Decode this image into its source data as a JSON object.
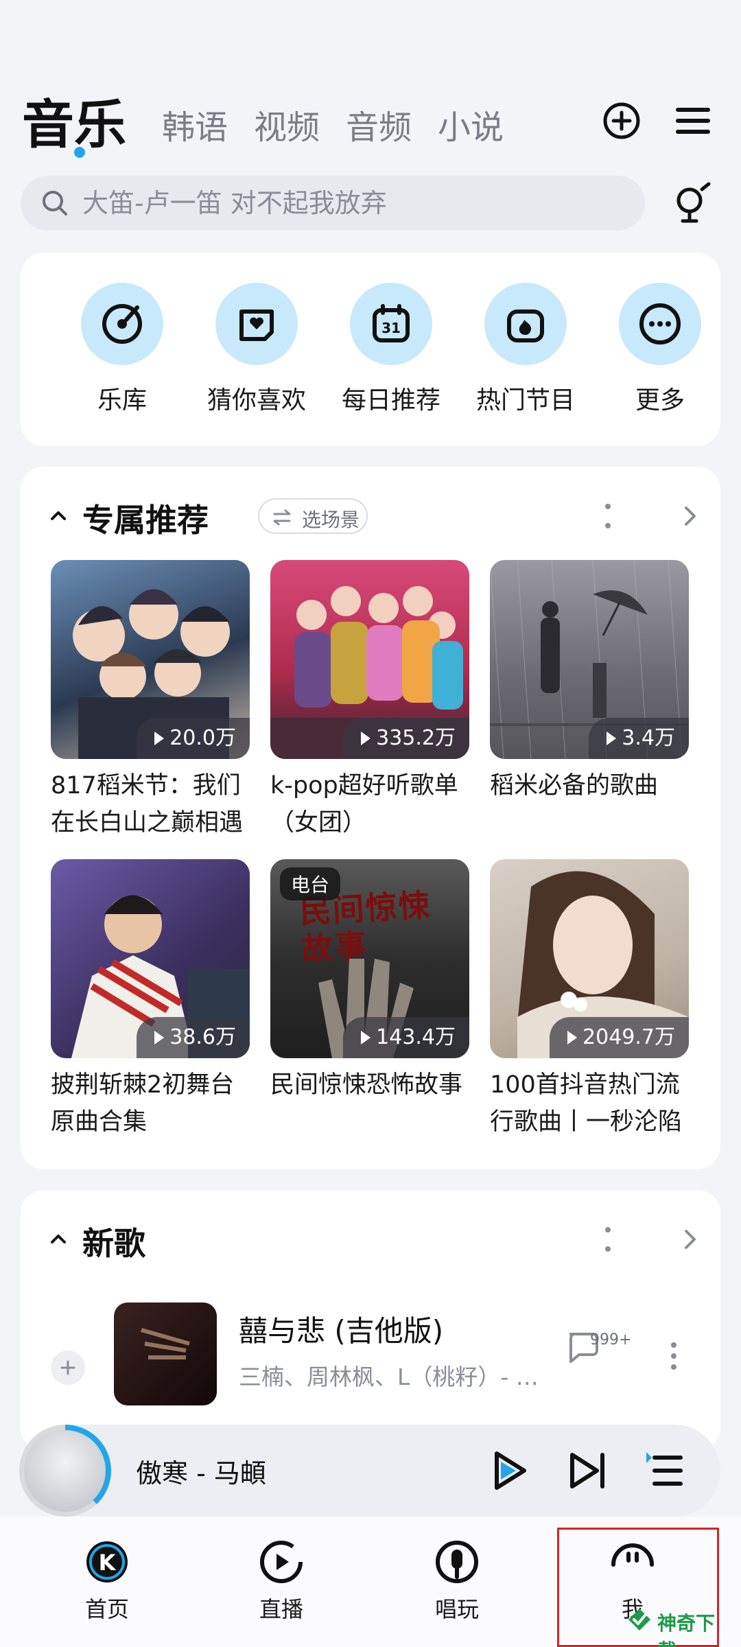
{
  "top_tabs": {
    "active": "音乐",
    "items": [
      "韩语",
      "视频",
      "音频",
      "小说"
    ]
  },
  "search": {
    "placeholder": "大笛-卢一笛 对不起我放弃"
  },
  "quick_entries": [
    {
      "label": "乐库",
      "icon": "vinyl-icon"
    },
    {
      "label": "猜你喜欢",
      "icon": "heart-box-icon"
    },
    {
      "label": "每日推荐",
      "icon": "calendar-icon"
    },
    {
      "label": "热门节目",
      "icon": "flame-icon"
    },
    {
      "label": "更多",
      "icon": "more-dots-icon"
    }
  ],
  "recommend": {
    "title": "专属推荐",
    "chip": "选场景",
    "tiles": [
      {
        "title": "817稻米节：我们在长白山之巅相遇",
        "plays": "20.0万"
      },
      {
        "title": "k-pop超好听歌单（女团）",
        "plays": "335.2万"
      },
      {
        "title": "稻米必备的歌曲",
        "plays": "3.4万"
      },
      {
        "title": "披荆斩棘2初舞台原曲合集",
        "plays": "38.6万"
      },
      {
        "title": "民间惊悚恐怖故事",
        "plays": "143.4万",
        "badge": "电台",
        "cover_text": "民间惊悚故事"
      },
      {
        "title": "100首抖音热门流行歌曲丨一秒沦陷",
        "plays": "2049.7万"
      }
    ]
  },
  "new_songs": {
    "title": "新歌",
    "song": {
      "title": "囍与悲 (吉他版)",
      "artists": "三楠、周林枫、L（桃籽）- 囍与悲",
      "comments": "999+"
    }
  },
  "player": {
    "track": "傲寒  -  马頔",
    "progress": 0.38
  },
  "bottom_nav": [
    {
      "label": "首页"
    },
    {
      "label": "直播"
    },
    {
      "label": "唱玩"
    },
    {
      "label": "我"
    }
  ],
  "watermark": "神奇下载"
}
